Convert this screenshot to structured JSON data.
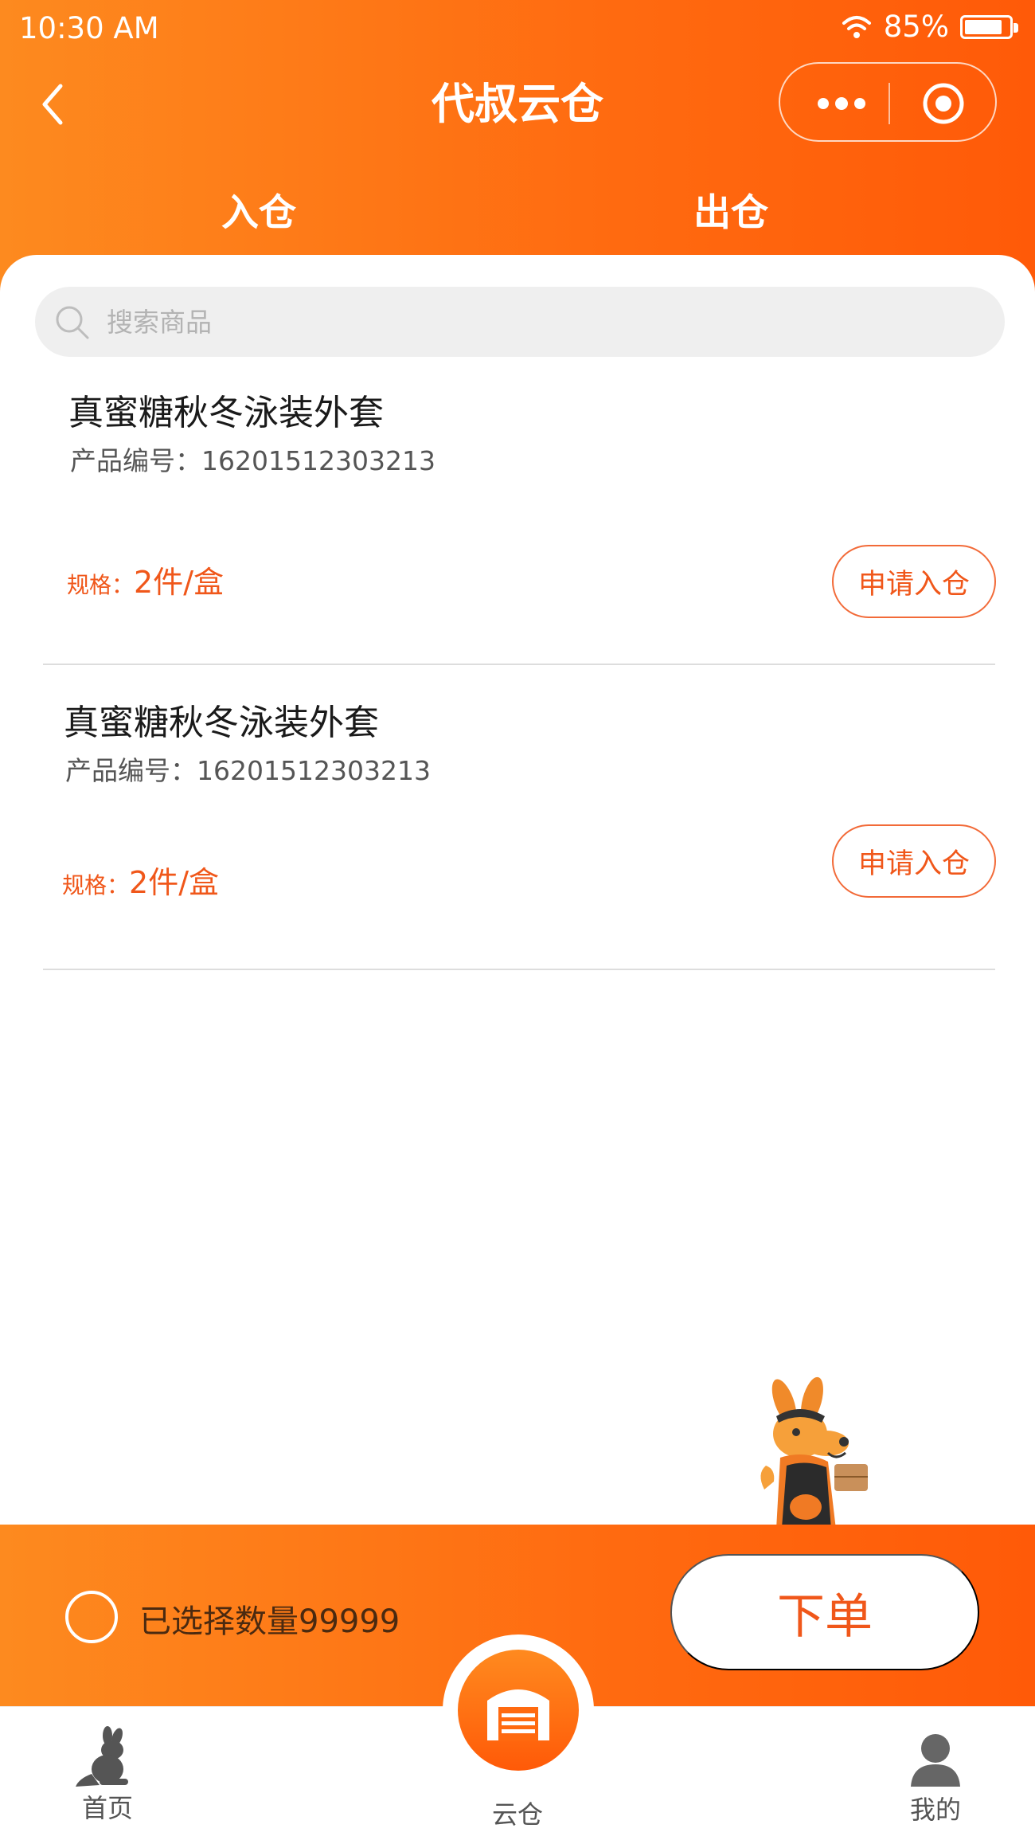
{
  "status_bar": {
    "time": "10:30 AM",
    "battery_percent": "85%",
    "battery_level": 0.85
  },
  "nav": {
    "title": "代叔云仓"
  },
  "tabs": [
    {
      "label": "入仓",
      "active": true
    },
    {
      "label": "出仓",
      "active": false
    }
  ],
  "search": {
    "placeholder": "搜索商品",
    "value": ""
  },
  "products": [
    {
      "name": "真蜜糖秋冬泳装外套",
      "code": "产品编号：16201512303213",
      "spec_label": "规格：",
      "spec_value": "2件/盒",
      "button": "申请入仓"
    },
    {
      "name": "真蜜糖秋冬泳装外套",
      "code": "产品编号：16201512303213",
      "spec_label": "规格：",
      "spec_value": "2件/盒",
      "button": "申请入仓"
    }
  ],
  "order_bar": {
    "selected_text": "已选择数量99999",
    "order_button": "下单"
  },
  "tabbar": {
    "home": "首页",
    "cloud": "云仓",
    "mine": "我的"
  },
  "colors": {
    "accent": "#ff6a10",
    "accent_light": "#fd8a1f",
    "text_orange": "#f0571a"
  }
}
